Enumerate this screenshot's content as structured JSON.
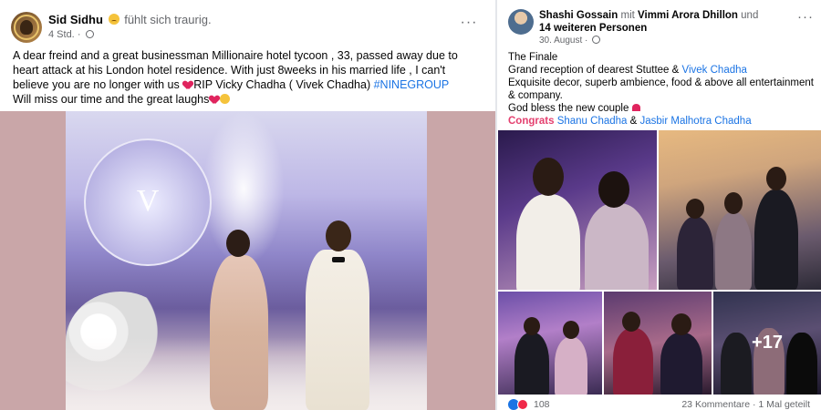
{
  "left_post": {
    "author": "Sid Sidhu",
    "feeling": "fühlt sich traurig.",
    "time": "4 Std.",
    "text_line1": "A dear freind and a great businessman Millionaire hotel tycoon , 33, passed away due to heart attack at his London hotel residence. With just 8weeks in his married life , I can't believe you are no longer with us",
    "text_rip": "RIP Vicky Chadha ( Vivek Chadha)",
    "hashtag": "#NINEGROUP",
    "text_line2": "Will miss our time and the great laughs",
    "photo_logo": "V"
  },
  "right_post": {
    "author": "Shashi Gossain",
    "with_word": "mit",
    "tagged": "Vimmi Arora Dhillon",
    "and_word": "und",
    "others": "14 weiteren Personen",
    "date": "30. August",
    "line1": "The Finale",
    "line2_pre": "Grand reception of dearest Stuttee &",
    "line2_link": "Vivek Chadha",
    "line3": "Exquisite decor, superb ambience, food & above all entertainment & company.",
    "line4": "God bless the new couple",
    "congrats_label": "Congrats",
    "congrats_name1": "Shanu Chadha",
    "congrats_amp": "&",
    "congrats_name2": "Jasbir Malhotra Chadha",
    "more_photos": "+17",
    "reaction_count": "108",
    "comments_info": "23 Kommentare · 1 Mal geteilt"
  },
  "colors": {
    "link": "#1b74e4",
    "secondary_text": "#65676b",
    "congrats": "#e4406f",
    "photo_background": "#c9a6a8"
  },
  "icons": {
    "left_more": "more-horizontal-icon",
    "right_more": "more-horizontal-icon",
    "audience": "globe-icon",
    "feeling": "sad-face-icon"
  }
}
